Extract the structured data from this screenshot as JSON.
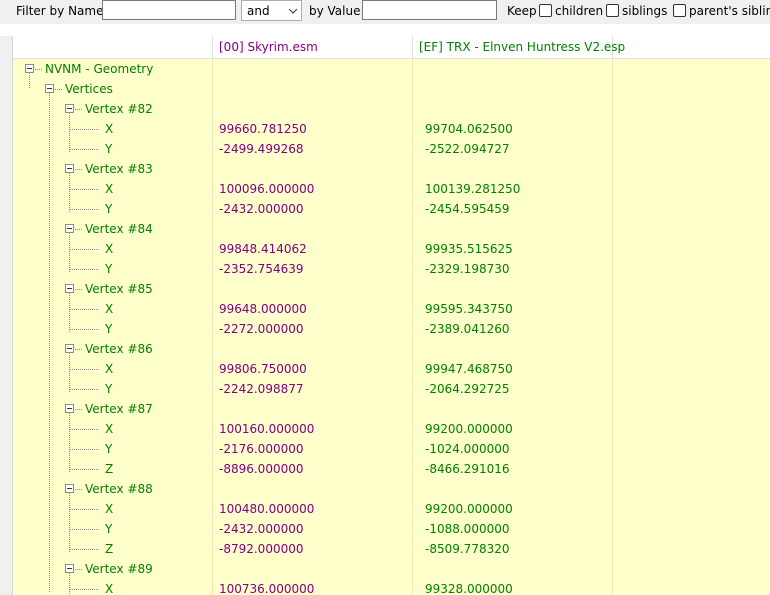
{
  "filter": {
    "name_label": "Filter by Name:",
    "name_value": "",
    "operator": "and",
    "value_label": "by Value:",
    "value_value": "",
    "keep_label": "Keep",
    "children_label": "children",
    "siblings_label": "siblings",
    "parents_label": "parent's siblings"
  },
  "columns": {
    "c1": "[00] Skyrim.esm",
    "c2": "[EF] TRX - Elnven Huntress V2.esp"
  },
  "tree": {
    "root": "NVNM - Geometry",
    "vertices": "Vertices",
    "v82": {
      "label": "Vertex #82",
      "x_label": "X",
      "x1": "99660.781250",
      "x2": "99704.062500",
      "y_label": "Y",
      "y1": "-2499.499268",
      "y2": "-2522.094727"
    },
    "v83": {
      "label": "Vertex #83",
      "x_label": "X",
      "x1": "100096.000000",
      "x2": "100139.281250",
      "y_label": "Y",
      "y1": "-2432.000000",
      "y2": "-2454.595459"
    },
    "v84": {
      "label": "Vertex #84",
      "x_label": "X",
      "x1": "99848.414062",
      "x2": "99935.515625",
      "y_label": "Y",
      "y1": "-2352.754639",
      "y2": "-2329.198730"
    },
    "v85": {
      "label": "Vertex #85",
      "x_label": "X",
      "x1": "99648.000000",
      "x2": "99595.343750",
      "y_label": "Y",
      "y1": "-2272.000000",
      "y2": "-2389.041260"
    },
    "v86": {
      "label": "Vertex #86",
      "x_label": "X",
      "x1": "99806.750000",
      "x2": "99947.468750",
      "y_label": "Y",
      "y1": "-2242.098877",
      "y2": "-2064.292725"
    },
    "v87": {
      "label": "Vertex #87",
      "x_label": "X",
      "x1": "100160.000000",
      "x2": "99200.000000",
      "y_label": "Y",
      "y1": "-2176.000000",
      "y2": "-1024.000000",
      "z_label": "Z",
      "z1": "-8896.000000",
      "z2": "-8466.291016"
    },
    "v88": {
      "label": "Vertex #88",
      "x_label": "X",
      "x1": "100480.000000",
      "x2": "99200.000000",
      "y_label": "Y",
      "y1": "-2432.000000",
      "y2": "-1088.000000",
      "z_label": "Z",
      "z1": "-8792.000000",
      "z2": "-8509.778320"
    },
    "v89": {
      "label": "Vertex #89",
      "x_label": "X",
      "x1": "100736.000000",
      "x2": "99328.000000"
    }
  }
}
